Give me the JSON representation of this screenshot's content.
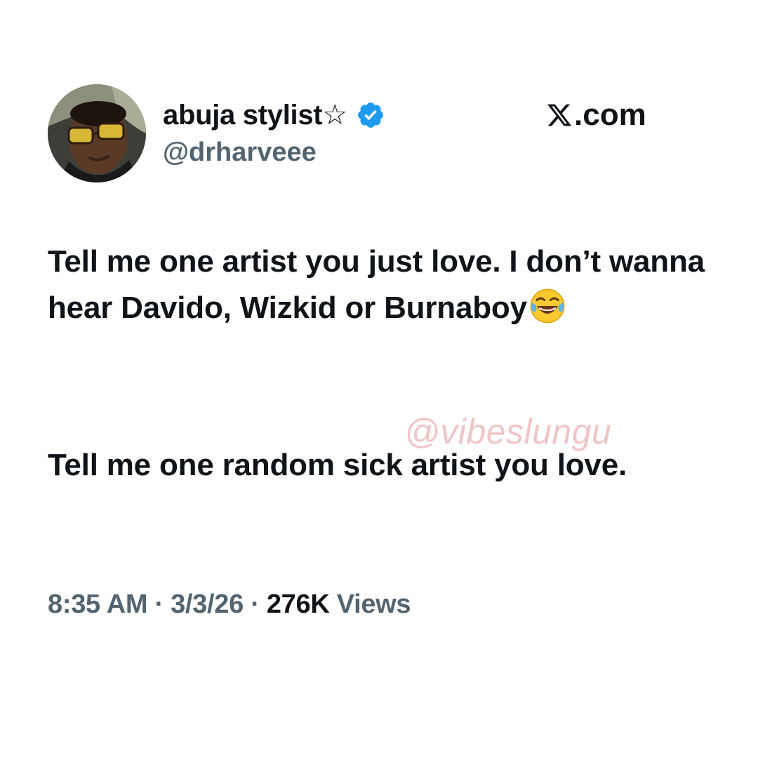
{
  "author": {
    "display_name": "abuja stylist☆",
    "handle": "@drharveee",
    "verified": true,
    "avatar": "profile-photo"
  },
  "site": {
    "label": ".com",
    "logo_icon": "x-logo-icon"
  },
  "tweet": {
    "paragraph1": "Tell me one artist you just love. I don’t wanna hear Davido, Wizkid or Burnaboy",
    "paragraph1_emoji": "face-with-tears-of-joy",
    "paragraph2": "Tell me one random sick artist you love."
  },
  "watermark": {
    "text": "@vibeslungu"
  },
  "meta": {
    "time": "8:35 AM",
    "separator1": " · ",
    "date": "3/3/26",
    "separator2": " · ",
    "views_count": "276K",
    "views_label": " Views"
  },
  "colors": {
    "text": "#0f1419",
    "secondary": "#536471",
    "verified": "#1d9bf0",
    "watermark": "#e29698",
    "background": "#ffffff"
  }
}
